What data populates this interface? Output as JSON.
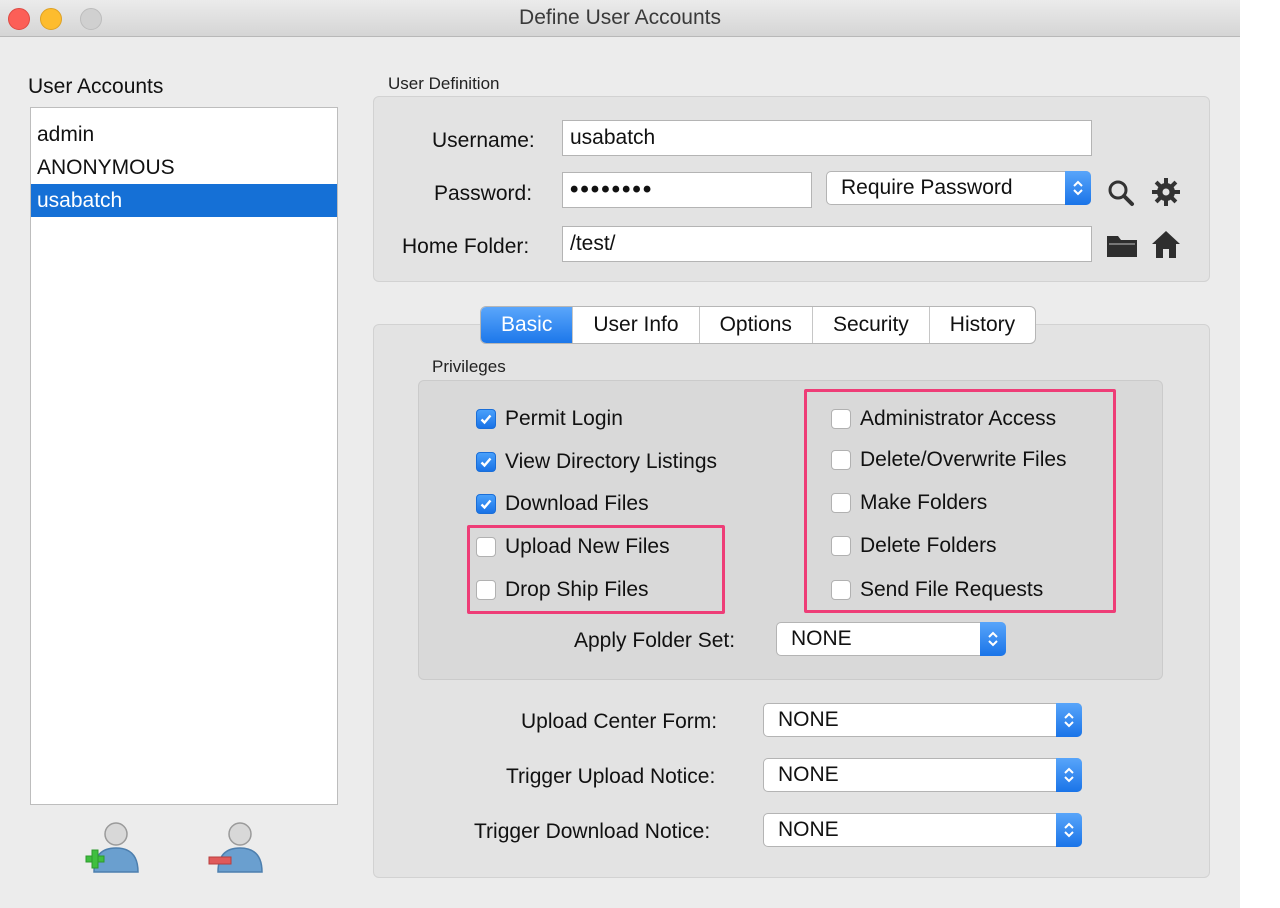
{
  "window": {
    "title": "Define User Accounts"
  },
  "sidebar": {
    "heading": "User Accounts",
    "users": [
      "admin",
      "ANONYMOUS",
      "usabatch"
    ],
    "selected_index": 2
  },
  "user_definition": {
    "heading": "User Definition",
    "username_label": "Username:",
    "username_value": "usabatch",
    "password_label": "Password:",
    "password_value": "••••••••",
    "password_mode": "Require Password",
    "home_folder_label": "Home Folder:",
    "home_folder_value": "/test/"
  },
  "tabs": [
    "Basic",
    "User Info",
    "Options",
    "Security",
    "History"
  ],
  "active_tab": "Basic",
  "privileges": {
    "heading": "Privileges",
    "left": [
      {
        "label": "Permit Login",
        "checked": true
      },
      {
        "label": "View Directory Listings",
        "checked": true
      },
      {
        "label": "Download Files",
        "checked": true
      },
      {
        "label": "Upload New Files",
        "checked": false
      },
      {
        "label": "Drop Ship Files",
        "checked": false
      }
    ],
    "right": [
      {
        "label": "Administrator Access",
        "checked": false
      },
      {
        "label": "Delete/Overwrite Files",
        "checked": false
      },
      {
        "label": "Make Folders",
        "checked": false
      },
      {
        "label": "Delete Folders",
        "checked": false
      },
      {
        "label": "Send File Requests",
        "checked": false
      }
    ],
    "folder_set_label": "Apply Folder Set:",
    "folder_set_value": "NONE"
  },
  "forms": {
    "upload_center_label": "Upload Center Form:",
    "upload_center_value": "NONE",
    "trigger_upload_label": "Trigger Upload Notice:",
    "trigger_upload_value": "NONE",
    "trigger_download_label": "Trigger Download Notice:",
    "trigger_download_value": "NONE"
  },
  "colors": {
    "accent": "#1570d6",
    "highlight": "#ee3d77"
  },
  "icons": {
    "add_user": "add-user-icon",
    "remove_user": "remove-user-icon",
    "search": "search-icon",
    "gear": "gear-icon",
    "folder": "folder-icon",
    "home": "home-icon"
  }
}
